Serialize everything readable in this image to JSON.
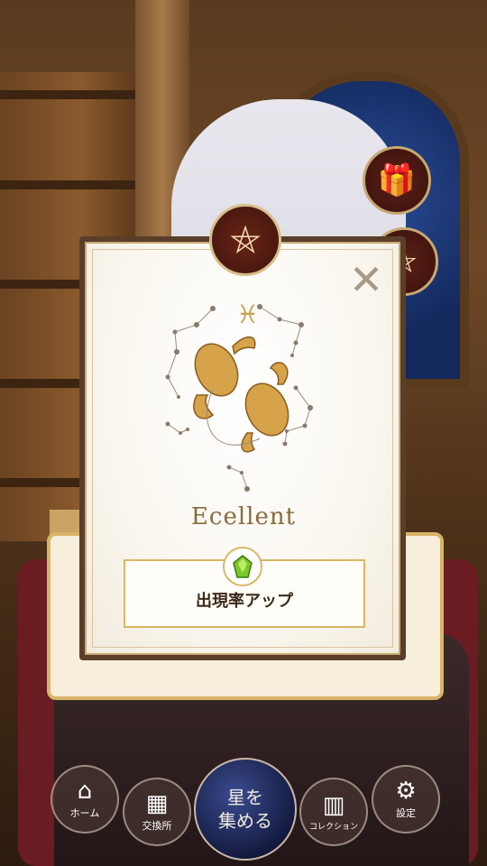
{
  "dialog": {
    "title": "Ecellent",
    "bonus_label": "出現率アップ",
    "close_glyph": "✕",
    "zodiac_symbol": "♓",
    "medallion_symbol": "⛤"
  },
  "side_buttons": {
    "gift_icon": "🎁",
    "second_icon": "⛤"
  },
  "nav": {
    "home_label": "ホーム",
    "exchange_label": "交換所",
    "gather_label_line1": "星を",
    "gather_label_line2": "集める",
    "collection_label": "コレクション",
    "settings_label": "設定"
  },
  "colors": {
    "gold": "#d8b866",
    "dark_red": "#5a1f16",
    "title_brown": "#8a6a3c",
    "gem_green": "#7cc62a"
  }
}
